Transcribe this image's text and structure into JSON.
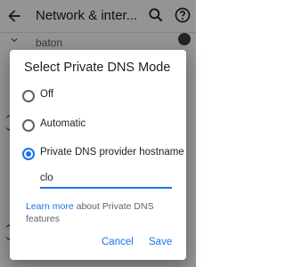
{
  "background": {
    "app_bar": {
      "title": "Network & inter...",
      "back_icon": "arrow-back-icon",
      "search_icon": "search-icon",
      "help_icon": "help-icon"
    },
    "partial_row_text": "baton"
  },
  "dialog": {
    "title": "Select Private DNS Mode",
    "options": [
      {
        "label": "Off",
        "selected": false
      },
      {
        "label": "Automatic",
        "selected": false
      },
      {
        "label": "Private DNS provider hostname",
        "selected": true
      }
    ],
    "hostname_value": "clo",
    "learn_more_link": "Learn more",
    "learn_more_text": " about Private DNS features",
    "cancel_label": "Cancel",
    "save_label": "Save"
  },
  "colors": {
    "accent": "#1a73e8",
    "scrim": "rgba(0,0,0,0.42)"
  }
}
